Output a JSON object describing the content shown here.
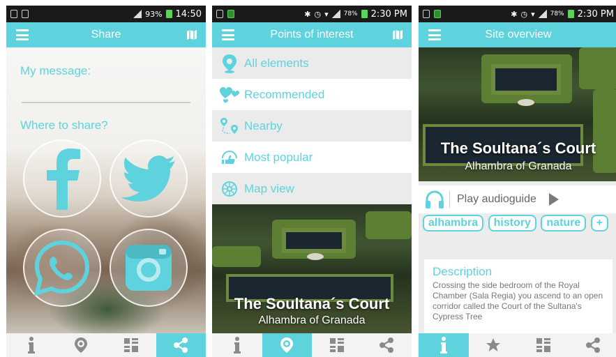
{
  "screens": [
    {
      "status": {
        "right_text": "93%",
        "time": "14:50"
      },
      "title": "Share",
      "my_message_label": "My message:",
      "where_label": "Where to share?",
      "share_targets": [
        "facebook",
        "twitter",
        "whatsapp",
        "instagram"
      ],
      "active_tab": 3
    },
    {
      "status": {
        "right_text": "78%",
        "time": "2:30 PM"
      },
      "title": "Points of interest",
      "menu_items": [
        {
          "label": "All elements",
          "icon": "location-pin-icon"
        },
        {
          "label": "Recommended",
          "icon": "hearts-icon"
        },
        {
          "label": "Nearby",
          "icon": "route-icon"
        },
        {
          "label": "Most popular",
          "icon": "thumbs-up-icon"
        },
        {
          "label": "Map view",
          "icon": "compass-icon"
        }
      ],
      "hero_title": "The Soultana´s Court",
      "hero_subtitle": "Alhambra of Granada",
      "active_tab": 1
    },
    {
      "status": {
        "right_text": "78%",
        "time": "2:30 PM"
      },
      "title": "Site overview",
      "hero_title": "The Soultana´s Court",
      "hero_subtitle": "Alhambra of Granada",
      "play_label": "Play audioguide",
      "tags": [
        "alhambra",
        "history",
        "nature",
        "+"
      ],
      "description_title": "Description",
      "description_text": "Crossing the side bedroom of the Royal Chamber (Sala Regia) you ascend to an open corridor called the Court of the Sultana's Cypress Tree",
      "active_tab": 0
    }
  ],
  "bottom_tabs": [
    "info-icon",
    "star-icon",
    "grid-icon",
    "share-icon"
  ],
  "colors": {
    "accent": "#5fd3dd",
    "statusbar": "#1a1a1a",
    "bottombar": "#f3f3f3"
  }
}
